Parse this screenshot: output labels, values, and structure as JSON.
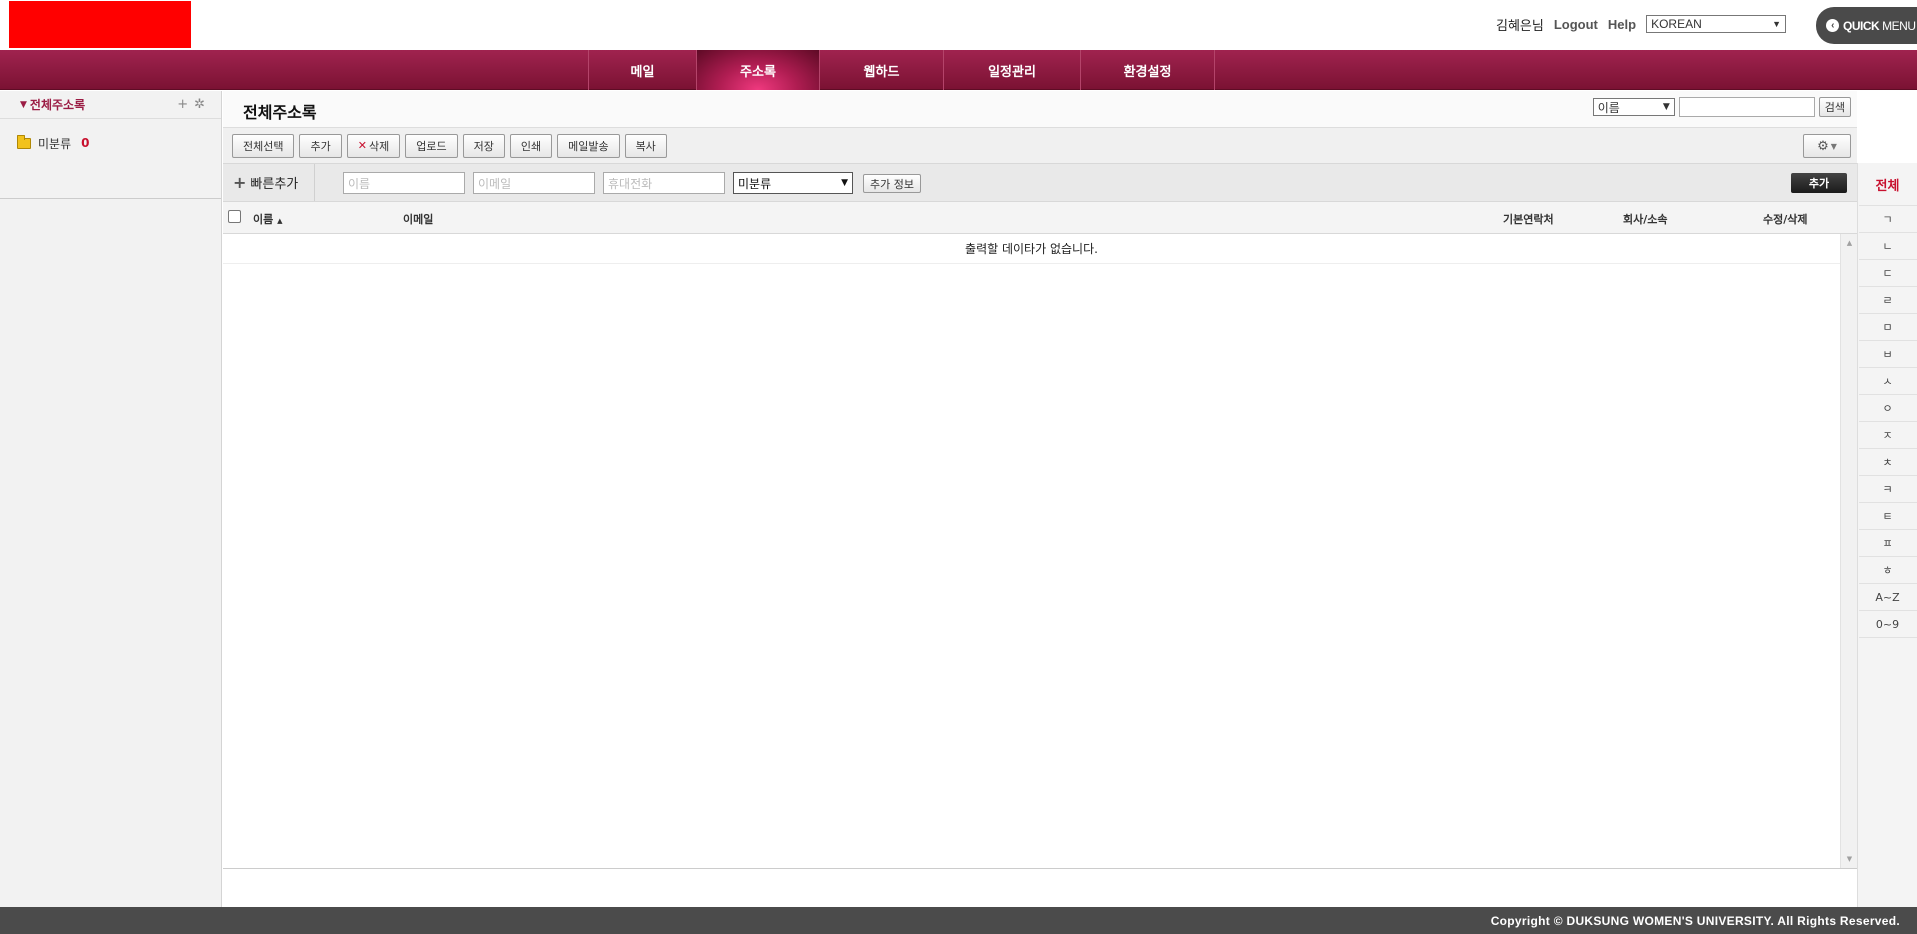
{
  "header": {
    "logo_color": "#ff0000",
    "user_name": "김혜은님",
    "logout_label": "Logout",
    "help_label": "Help",
    "language": "KOREAN",
    "quick_menu_strong": "QUICK",
    "quick_menu_rest": "MENU"
  },
  "nav": {
    "items": [
      {
        "label": "메일"
      },
      {
        "label": "주소록"
      },
      {
        "label": "웹하드"
      },
      {
        "label": "일정관리"
      },
      {
        "label": "환경설정"
      }
    ],
    "active_item": "주소록",
    "accent_color": "#8b1a3e"
  },
  "sidebar": {
    "title": "전체주소록",
    "folders": [
      {
        "label": "미분류",
        "count": "0"
      }
    ]
  },
  "main": {
    "title": "전체주소록",
    "search": {
      "field": "이름",
      "button_label": "검색"
    },
    "toolbar": {
      "buttons": [
        "전체선택",
        "추가",
        "삭제",
        "업로드",
        "저장",
        "인쇄",
        "메일발송",
        "복사"
      ]
    },
    "quick_add": {
      "label": "빠른추가",
      "name_placeholder": "이름",
      "email_placeholder": "이메일",
      "phone_placeholder": "휴대전화",
      "group_selected": "미분류",
      "info_button": "추가 정보",
      "add_button": "추가"
    },
    "table": {
      "columns": [
        "이름",
        "이메일",
        "기본연락처",
        "회사/소속",
        "수정/삭제"
      ],
      "sort_indicator": "▲",
      "empty_message": "출력할 데이타가 없습니다."
    }
  },
  "index": {
    "items": [
      "전체",
      "ㄱ",
      "ㄴ",
      "ㄷ",
      "ㄹ",
      "ㅁ",
      "ㅂ",
      "ㅅ",
      "ㅇ",
      "ㅈ",
      "ㅊ",
      "ㅋ",
      "ㅌ",
      "ㅍ",
      "ㅎ",
      "A~Z",
      "0~9"
    ]
  },
  "footer": {
    "copyright": "Copyright © DUKSUNG WOMEN'S UNIVERSITY. All Rights Reserved."
  }
}
